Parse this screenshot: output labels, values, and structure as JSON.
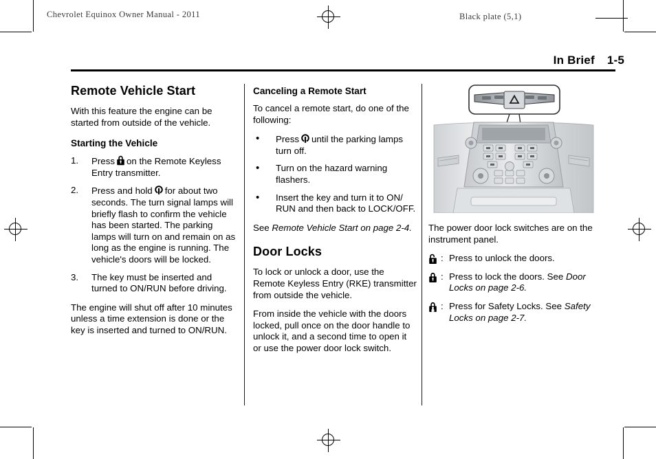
{
  "page": {
    "running_head_left": "Chevrolet Equinox Owner Manual - 2011",
    "running_head_right": "Black plate (5,1)",
    "section_title": "In Brief",
    "folio": "1-5"
  },
  "column1": {
    "heading": "Remote Vehicle Start",
    "intro": "With this feature the engine can be started from outside of the vehicle.",
    "subheading": "Starting the Vehicle",
    "steps": [
      {
        "num": "1.",
        "before": "Press",
        "icon": "lock-icon",
        "after": "on the Remote Keyless Entry transmitter."
      },
      {
        "num": "2.",
        "before": "Press and hold",
        "icon": "remote-start-icon",
        "after": "for about two seconds. The turn signal lamps will briefly flash to confirm the vehicle has been started. The parking lamps will turn on and remain on as long as the engine is running. The vehicle's doors will be locked."
      },
      {
        "num": "3.",
        "before": "",
        "icon": "",
        "after": "The key must be inserted and turned to ON/RUN before driving."
      }
    ],
    "closing": "The engine will shut off after 10 minutes unless a time extension is done or the key is inserted and turned to ON/RUN."
  },
  "column2": {
    "heading": "Canceling a Remote Start",
    "intro": "To cancel a remote start, do one of the following:",
    "bullets": [
      {
        "before": "Press",
        "icon": "remote-start-icon",
        "after": "until the parking lamps turn off."
      },
      {
        "before": "",
        "icon": "",
        "after": "Turn on the hazard warning flashers."
      },
      {
        "before": "",
        "icon": "",
        "after": "Insert the key and turn it to ON/ RUN and then back to LOCK/OFF."
      }
    ],
    "cross_ref_lead": "See",
    "cross_ref_italic": "Remote Vehicle Start on page 2-4.",
    "heading2": "Door Locks",
    "para1": "To lock or unlock a door, use the Remote Keyless Entry (RKE) transmitter from outside the vehicle.",
    "para2": "From inside the vehicle with the doors locked, pull once on the door handle to unlock it, and a second time to open it or use the power door lock switch."
  },
  "column3": {
    "figure_name": "instrument-panel-door-lock-switches-illustration",
    "caption": "The power door lock switches are on the instrument panel.",
    "legend": [
      {
        "icon": "unlock-icon",
        "colon": ":",
        "text": "Press to unlock the doors.",
        "italic": ""
      },
      {
        "icon": "lock-icon",
        "colon": ":",
        "text": "Press to lock the doors. See ",
        "italic": "Door Locks on page 2-6."
      },
      {
        "icon": "safety-lock-icon",
        "colon": ":",
        "text": "Press for Safety Locks. See ",
        "italic": "Safety Locks on page 2-7."
      }
    ]
  },
  "colors": {
    "text": "#000000",
    "head_rule": "#000000",
    "running_head": "#3a3a3a"
  }
}
